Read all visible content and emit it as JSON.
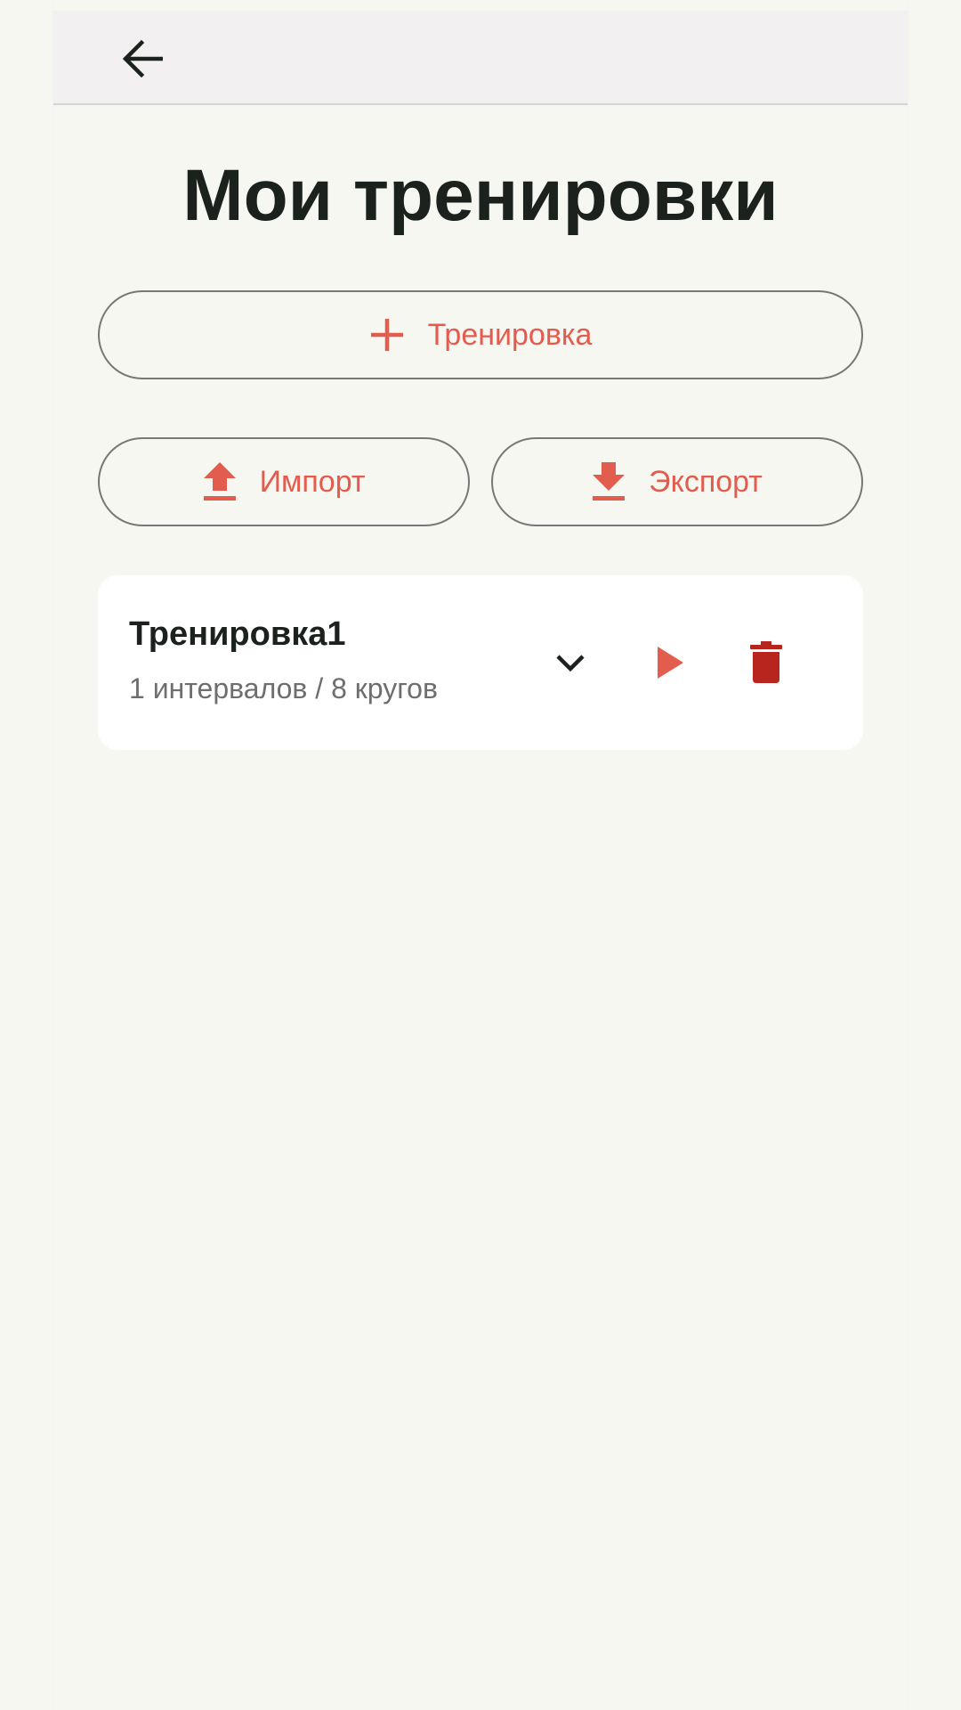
{
  "app_bar": {
    "back_icon": "arrow-left-icon"
  },
  "page": {
    "title": "Мои тренировки"
  },
  "actions": {
    "add": {
      "label": "Тренировка",
      "icon": "plus-icon"
    },
    "import": {
      "label": "Импорт",
      "icon": "upload-icon"
    },
    "export": {
      "label": "Экспорт",
      "icon": "download-icon"
    }
  },
  "workouts": [
    {
      "name": "Тренировка1",
      "summary": "1 интервалов / 8 кругов",
      "expand_icon": "chevron-down-icon",
      "play_icon": "play-icon",
      "delete_icon": "trash-icon"
    }
  ],
  "colors": {
    "accent": "#E35D4F",
    "delete": "#B8251F",
    "background": "#F7F7F2",
    "appbar": "#F2F0F0",
    "text_primary": "#1B221E",
    "text_secondary": "#6E6E6E"
  }
}
